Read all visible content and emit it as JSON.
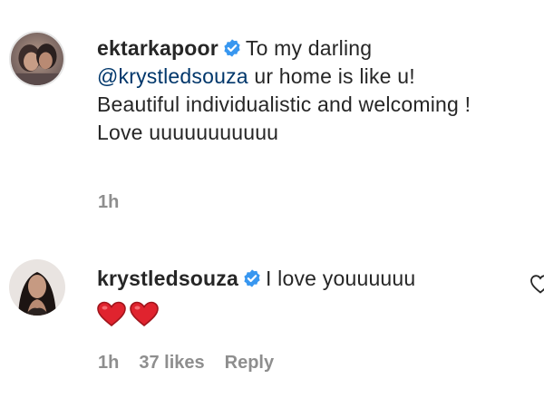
{
  "comments": [
    {
      "username": "ektarkapoor",
      "verified": true,
      "text_line1": "To my darling",
      "mention": "@krystledsouza",
      "text_line2_rest": " ur home is like u!",
      "text_line3": "Beautiful individualistic and welcoming !",
      "text_line4": "Love uuuuuuuuuuu",
      "time": "1h"
    },
    {
      "username": "krystledsouza",
      "verified": true,
      "text": "I love youuuuuu",
      "emoji": [
        "red-heart",
        "red-heart"
      ],
      "time": "1h",
      "likes": "37 likes",
      "reply_label": "Reply"
    }
  ],
  "colors": {
    "text": "#262626",
    "mention": "#00376b",
    "meta": "#8e8e8e",
    "verified": "#3897f0",
    "heart": "#e0232e"
  }
}
